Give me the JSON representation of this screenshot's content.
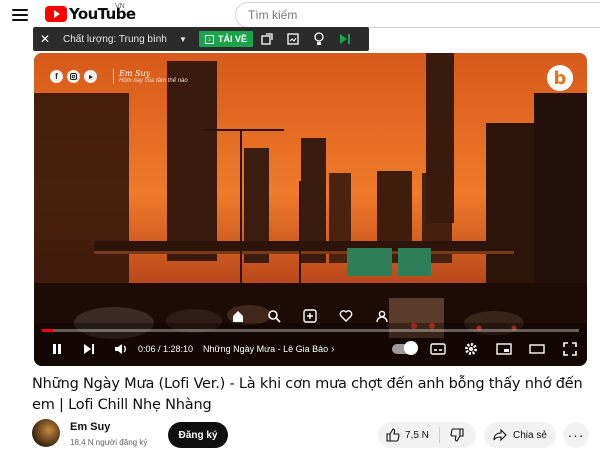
{
  "header": {
    "logo_text": "YouTube",
    "region": "VN",
    "search_placeholder": "Tìm kiếm"
  },
  "download_toolbar": {
    "quality_label": "Chất lượng: Trung bình",
    "download_label": "TẢI VỀ"
  },
  "video": {
    "overlay_channel": "Em Suy",
    "overlay_subtitle": "Hôm nay của tâm thế nào",
    "current_time": "0:06 / 1:28:10",
    "chapter": "Những Ngày Mưa - Lê Gia Bảo",
    "progress": 0.02
  },
  "title": "Những Ngày Mưa (Lofi Ver.) - Là khi cơn mưa chợt đến anh bỗng thấy nhớ đến em | Lofi Chill Nhẹ Nhàng",
  "channel": {
    "name": "Em Suy",
    "subscribers": "18,4 N người đăng ký",
    "subscribe_label": "Đăng ký"
  },
  "actions": {
    "likes": "7,5 N",
    "share_label": "Chia sẻ"
  },
  "colors": {
    "accent": "#ff0000",
    "download_green": "#1aa34a",
    "sky_top": "#e2641f",
    "sky_bottom": "#7a2b10"
  }
}
